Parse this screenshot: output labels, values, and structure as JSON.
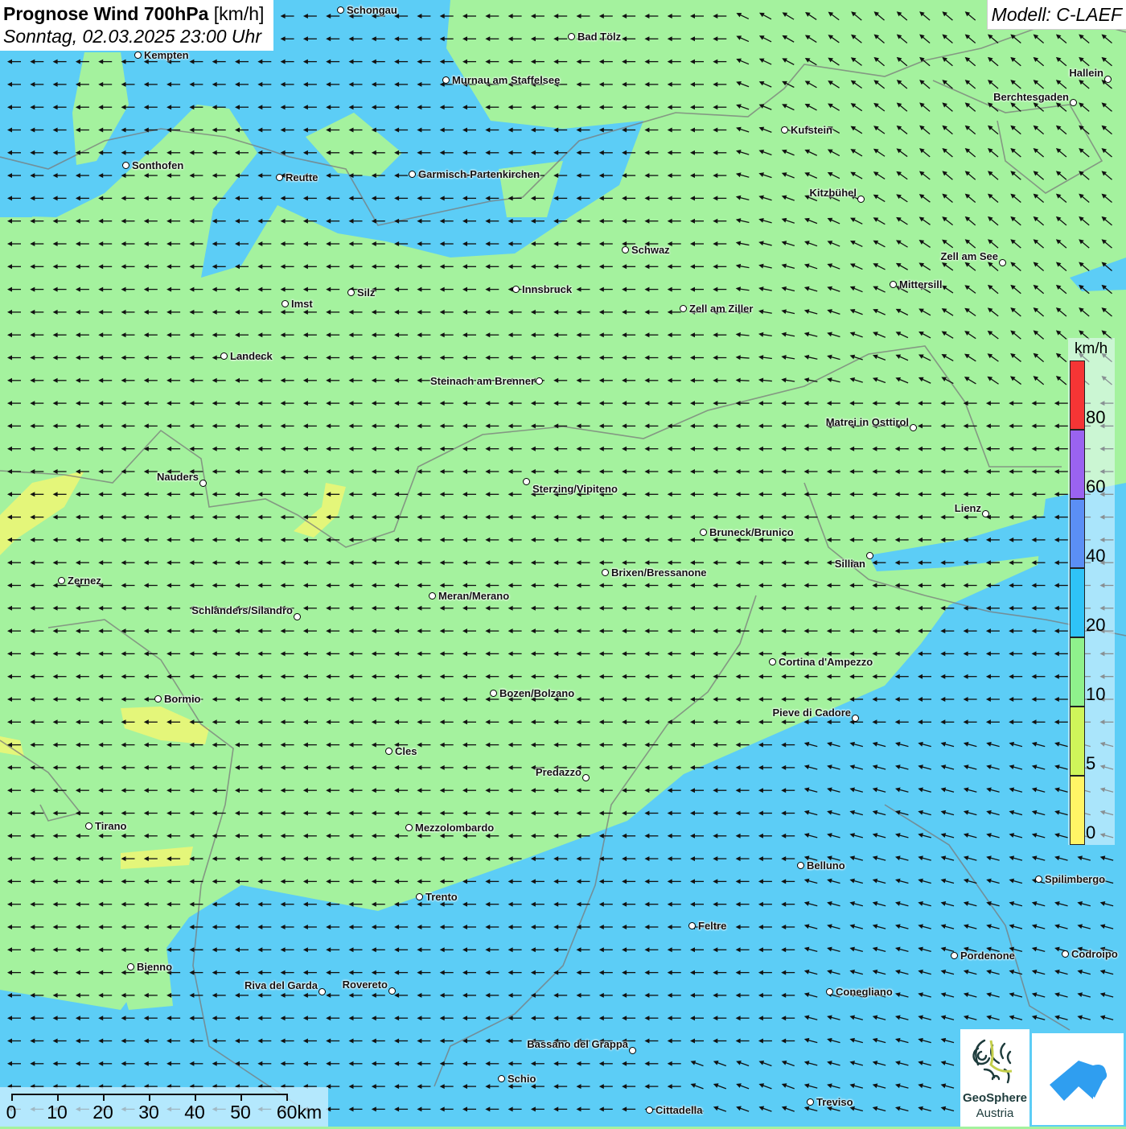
{
  "header": {
    "title_bold": "Prognose Wind 700hPa",
    "title_unit": "[km/h]",
    "datetime": "Sonntag, 02.03.2025 23:00 Uhr"
  },
  "model_label": "Modell: C-LAEF",
  "colors": {
    "land_green": "#a4f29e",
    "wind_blue": "#5ccdf6",
    "yellow": "#e4f67a"
  },
  "cities": [
    "Schongau",
    "Bad Tölz",
    "Kempten",
    "Murnau am Staffelsee",
    "Hallein",
    "Berchtesgaden",
    "Kufstein",
    "Sonthofen",
    "Reutte",
    "Garmisch-Partenkirchen",
    "Kitzbühel",
    "Schwaz",
    "Zell am See",
    "Innsbruck",
    "Silz",
    "Mittersill",
    "Imst",
    "Zell am Ziller",
    "Landeck",
    "Steinach am Brenner",
    "Matrei in Osttirol",
    "Nauders",
    "Sterzing/Vipiteno",
    "Lienz",
    "Bruneck/Brunico",
    "Sillian",
    "Brixen/Bressanone",
    "Zernez",
    "Meran/Merano",
    "Schlanders/Silandro",
    "Cortina d'Ampezzo",
    "Bozen/Bolzano",
    "Bormio",
    "Pieve di Cadore",
    "Cles",
    "Predazzo",
    "Tirano",
    "Mezzolombardo",
    "Belluno",
    "Spilimbergo",
    "Trento",
    "Feltre",
    "Pordenone",
    "Codroipo",
    "Bienno",
    "Riva del Garda",
    "Rovereto",
    "Conegliano",
    "Bassano del Grappa",
    "Schio",
    "Treviso",
    "Cittadella"
  ],
  "legend": {
    "unit": "km/h",
    "classes": [
      {
        "label": "80",
        "color": "#f53535"
      },
      {
        "label": "60",
        "color": "#9a63f0"
      },
      {
        "label": "40",
        "color": "#5b8ff5"
      },
      {
        "label": "20",
        "color": "#2fc3f7"
      },
      {
        "label": "10",
        "color": "#8ff18c"
      },
      {
        "label": "5",
        "color": "#cff55a"
      },
      {
        "label": "0",
        "color": "#fff566"
      }
    ]
  },
  "scale_bar": {
    "labels": [
      "0",
      "10",
      "20",
      "30",
      "40",
      "50",
      "60km"
    ]
  },
  "logos": {
    "geosphere_line1": "GeoSphere",
    "geosphere_line2": "Austria"
  }
}
